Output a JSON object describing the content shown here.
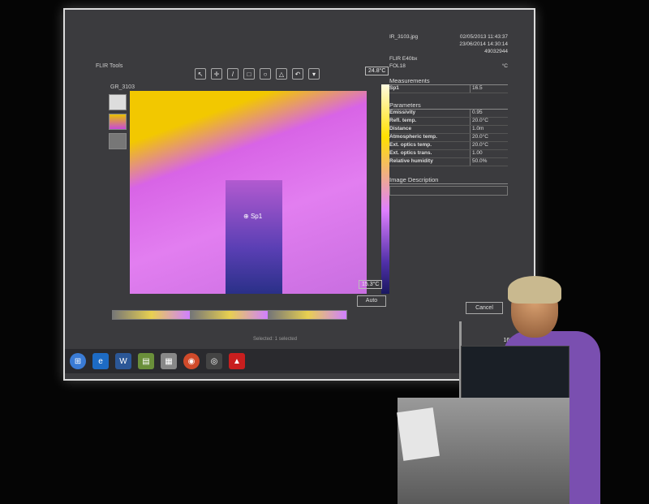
{
  "window": {
    "title": "FLIR Tools",
    "document": "GR_3103"
  },
  "toolbar": [
    "↖",
    "✛",
    "/",
    "□",
    "○",
    "△",
    "↶",
    "▾"
  ],
  "image": {
    "spot_label": "Sp1",
    "temp_max": "24.8°C",
    "temp_min": "15.3°C",
    "auto_button": "Auto"
  },
  "meta": {
    "filename": "IR_3103.jpg",
    "date1": "02/05/2013 11:43:37",
    "date2": "23/06/2014 14:30:14",
    "serial": "49032944",
    "camera": "FLIR E40bx",
    "lens": "FOL18",
    "unit": "°C"
  },
  "measurements": {
    "title": "Measurements",
    "label": "Sp1",
    "value": "16.5"
  },
  "parameters": {
    "title": "Parameters",
    "rows": [
      {
        "k": "Emissivity",
        "v": "0.95"
      },
      {
        "k": "Refl. temp.",
        "v": "20.0°C"
      },
      {
        "k": "Distance",
        "v": "1.0m"
      },
      {
        "k": "Atmospheric temp.",
        "v": "20.0°C"
      },
      {
        "k": "Ext. optics temp.",
        "v": "20.0°C"
      },
      {
        "k": "Ext. optics trans.",
        "v": "1.00"
      },
      {
        "k": "Relative humidity",
        "v": "50.0%"
      }
    ]
  },
  "description": {
    "title": "Image Description"
  },
  "cancel": "Cancel",
  "status": "Selected: 1 selected",
  "clock": "16:35"
}
